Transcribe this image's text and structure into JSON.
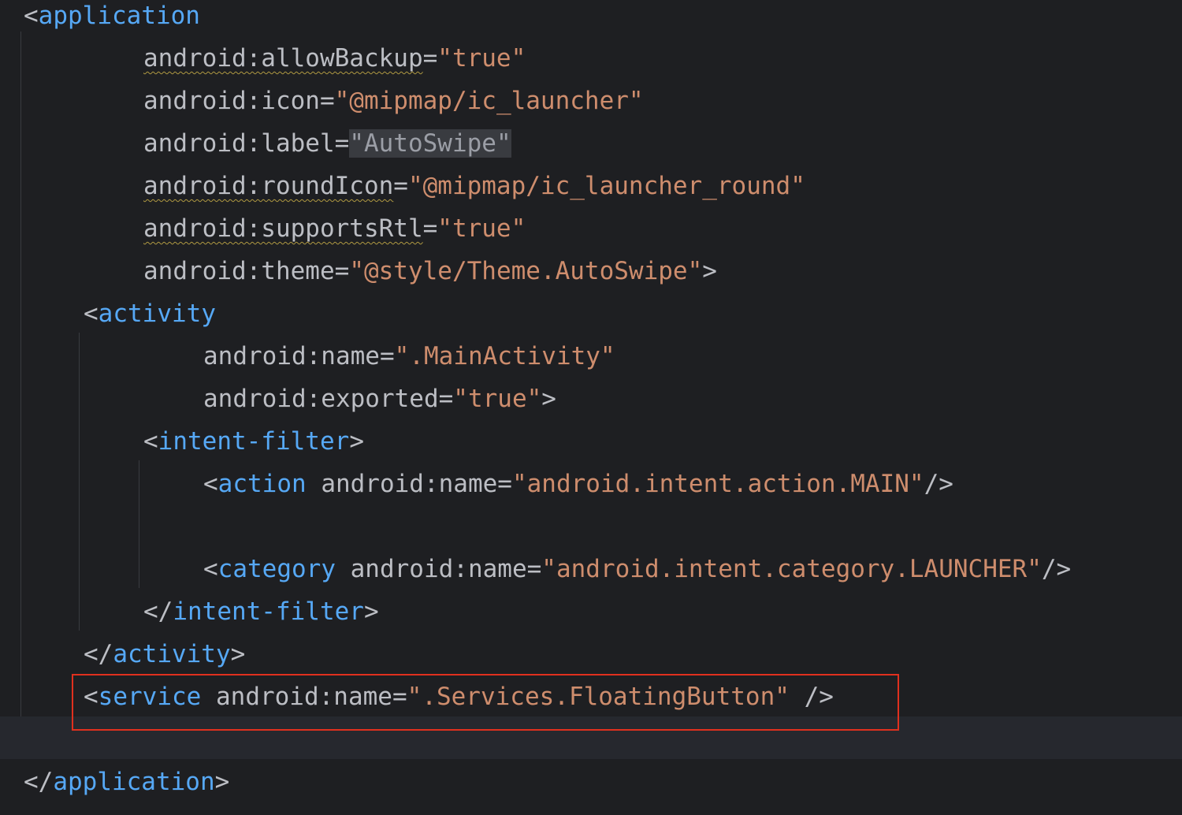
{
  "editor": {
    "lines": [
      {
        "indent": 1,
        "parts": [
          [
            "punct",
            "<"
          ],
          [
            "tag",
            "application"
          ]
        ]
      },
      {
        "indent": 4,
        "parts": [
          [
            "attr warn",
            "android:allowBackup"
          ],
          [
            "punct",
            "="
          ],
          [
            "val orange",
            "\"true\""
          ]
        ]
      },
      {
        "indent": 4,
        "parts": [
          [
            "attr",
            "android:icon"
          ],
          [
            "punct",
            "="
          ],
          [
            "val orange",
            "\"@mipmap/ic_launcher\""
          ]
        ]
      },
      {
        "indent": 4,
        "parts": [
          [
            "attr",
            "android:label"
          ],
          [
            "punct",
            "="
          ],
          [
            "val sel",
            "\"AutoSwipe\""
          ]
        ]
      },
      {
        "indent": 4,
        "parts": [
          [
            "attr warn",
            "android:roundIcon"
          ],
          [
            "punct",
            "="
          ],
          [
            "val orange",
            "\"@mipmap/ic_launcher_round\""
          ]
        ]
      },
      {
        "indent": 4,
        "parts": [
          [
            "attr warn",
            "android:supportsRtl"
          ],
          [
            "punct",
            "="
          ],
          [
            "val orange",
            "\"true\""
          ]
        ]
      },
      {
        "indent": 4,
        "parts": [
          [
            "attr",
            "android:theme"
          ],
          [
            "punct",
            "="
          ],
          [
            "val orange",
            "\"@style/Theme.AutoSwipe\""
          ],
          [
            "punct",
            ">"
          ]
        ]
      },
      {
        "indent": 2,
        "parts": [
          [
            "punct",
            "<"
          ],
          [
            "tag",
            "activity"
          ]
        ]
      },
      {
        "indent": 6,
        "parts": [
          [
            "attr",
            "android:name"
          ],
          [
            "punct",
            "="
          ],
          [
            "val orange",
            "\".MainActivity\""
          ]
        ]
      },
      {
        "indent": 6,
        "parts": [
          [
            "attr",
            "android:exported"
          ],
          [
            "punct",
            "="
          ],
          [
            "val orange",
            "\"true\""
          ],
          [
            "punct",
            ">"
          ]
        ]
      },
      {
        "indent": 4,
        "parts": [
          [
            "punct",
            "<"
          ],
          [
            "tag",
            "intent-filter"
          ],
          [
            "punct",
            ">"
          ]
        ]
      },
      {
        "indent": 6,
        "parts": [
          [
            "punct",
            "<"
          ],
          [
            "tag",
            "action"
          ],
          [
            "attr",
            " android:name"
          ],
          [
            "punct",
            "="
          ],
          [
            "val orange",
            "\"android.intent.action.MAIN\""
          ],
          [
            "punct",
            "/>"
          ]
        ]
      },
      {
        "indent": 0,
        "parts": []
      },
      {
        "indent": 6,
        "parts": [
          [
            "punct",
            "<"
          ],
          [
            "tag",
            "category"
          ],
          [
            "attr",
            " android:name"
          ],
          [
            "punct",
            "="
          ],
          [
            "val orange",
            "\"android.intent.category.LAUNCHER\""
          ],
          [
            "punct",
            "/>"
          ]
        ]
      },
      {
        "indent": 4,
        "parts": [
          [
            "punct",
            "</"
          ],
          [
            "tag",
            "intent-filter"
          ],
          [
            "punct",
            ">"
          ]
        ]
      },
      {
        "indent": 2,
        "parts": [
          [
            "punct",
            "</"
          ],
          [
            "tag",
            "activity"
          ],
          [
            "punct",
            ">"
          ]
        ]
      },
      {
        "indent": 2,
        "parts": [
          [
            "punct",
            "<"
          ],
          [
            "tag",
            "service"
          ],
          [
            "attr",
            " android:name"
          ],
          [
            "punct",
            "="
          ],
          [
            "val orange",
            "\".Services.FloatingButton\""
          ],
          [
            "punct",
            " />"
          ]
        ]
      },
      {
        "indent": 0,
        "parts": []
      },
      {
        "indent": 1,
        "parts": [
          [
            "punct",
            "</"
          ],
          [
            "tag",
            "application"
          ],
          [
            "punct",
            ">"
          ]
        ]
      }
    ]
  },
  "colors": {
    "background": "#1e1f22",
    "tag": "#56a8f5",
    "string": "#ce8d6d",
    "highlight_border": "#e0301e"
  }
}
